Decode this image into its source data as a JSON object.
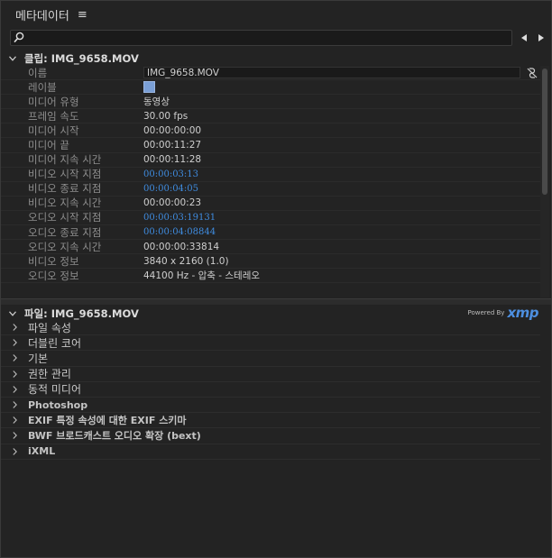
{
  "panel": {
    "title": "메타데이터",
    "menu_icon": "≡"
  },
  "search": {
    "icon": "search-icon",
    "placeholder": ""
  },
  "clip_section": {
    "prefix": "클립: ",
    "filename": "IMG_9658.MOV",
    "rows": [
      {
        "label": "이름",
        "value": "IMG_9658.MOV"
      },
      {
        "label": "레이블",
        "value": "",
        "color": "#7a9fd6"
      },
      {
        "label": "미디어 유형",
        "value": "동영상"
      },
      {
        "label": "프레임 속도",
        "value": "30.00 fps"
      },
      {
        "label": "미디어 시작",
        "value": "00:00:00:00"
      },
      {
        "label": "미디어 끝",
        "value": "00:00:11:27"
      },
      {
        "label": "미디어 지속 시간",
        "value": "00:00:11:28"
      },
      {
        "label": "비디오 시작 지점",
        "value": "00:00:03:13"
      },
      {
        "label": "비디오 종료 지점",
        "value": "00:00:04:05"
      },
      {
        "label": "비디오 지속 시간",
        "value": "00:00:00:23"
      },
      {
        "label": "오디오 시작 지점",
        "value": "00:00:03:19131"
      },
      {
        "label": "오디오 종료 지점",
        "value": "00:00:04:08844"
      },
      {
        "label": "오디오 지속 시간",
        "value": "00:00:00:33814"
      },
      {
        "label": "비디오 정보",
        "value": "3840 x 2160 (1.0)"
      },
      {
        "label": "오디오 정보",
        "value": "44100 Hz - 압축 - 스테레오"
      }
    ]
  },
  "file_section": {
    "prefix": "파일: ",
    "filename": "IMG_9658.MOV",
    "powered_by": "Powered By",
    "xmp": "xmp",
    "rows": [
      {
        "label": "파일 속성"
      },
      {
        "label": "더블린 코어"
      },
      {
        "label": "기본"
      },
      {
        "label": "권한 관리"
      },
      {
        "label": "동적 미디어"
      },
      {
        "label": "Photoshop"
      },
      {
        "label": "EXIF 특정 속성에 대한 EXIF 스키마"
      },
      {
        "label": "BWF 브로드캐스트 오디오 확장 (bext)"
      },
      {
        "label": "iXML"
      }
    ]
  },
  "colors": {
    "link_blue": "#3f8ce0",
    "label_swatch": "#7a9fd6",
    "xmp_blue": "#4d8fe0"
  }
}
